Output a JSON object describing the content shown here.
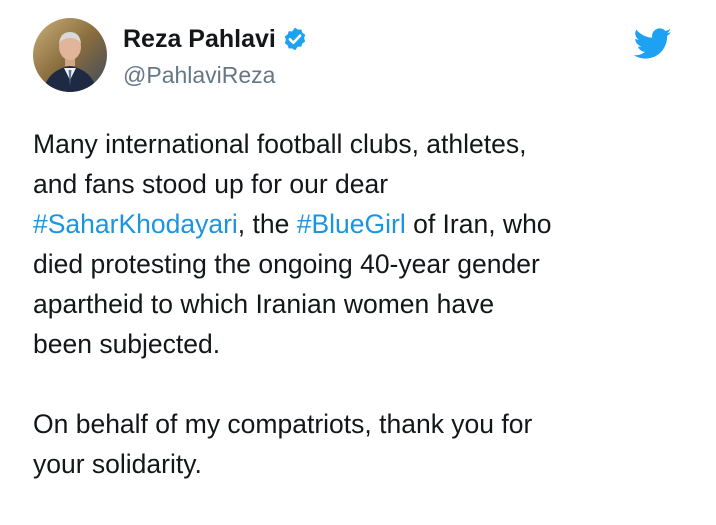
{
  "tweet": {
    "display_name": "Reza Pahlavi",
    "handle": "@PahlaviReza",
    "verified_icon": "verified-badge-icon",
    "brand_icon": "twitter-bird-icon",
    "colors": {
      "link": "#1b95e0",
      "handle": "#657786",
      "text": "#14171a",
      "brand": "#1da1f2"
    },
    "paragraph1": {
      "line1": "Many international football clubs, athletes,",
      "line2": "and fans stood up for our dear",
      "line3_hashtag1": "#SaharKhodayari",
      "line3_text1": ", the ",
      "line3_hashtag2": "#BlueGirl",
      "line3_text2": " of Iran, who",
      "line4": "died protesting the ongoing 40-year gender",
      "line5": "apartheid to which Iranian women have",
      "line6": "been subjected."
    },
    "paragraph2": {
      "line1": "On behalf of my compatriots, thank you for",
      "line2": "your solidarity."
    }
  }
}
